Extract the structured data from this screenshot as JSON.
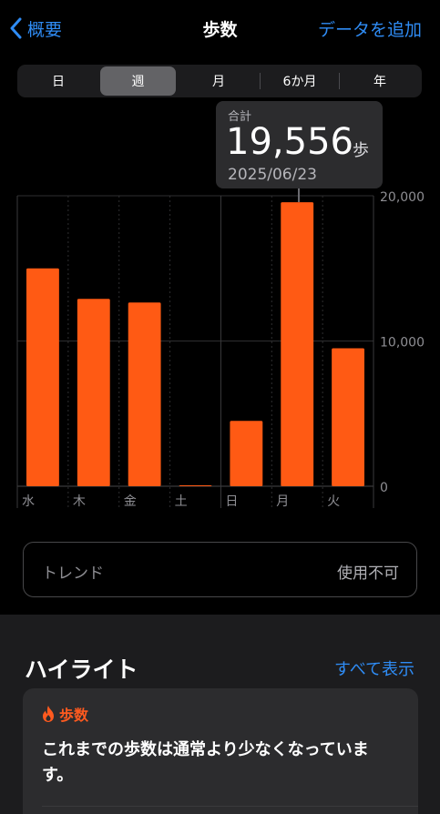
{
  "nav": {
    "back_label": "概要",
    "title": "歩数",
    "add_label": "データを追加"
  },
  "segments": [
    "日",
    "週",
    "月",
    "6か月",
    "年"
  ],
  "selected_segment": "週",
  "callout": {
    "label": "合計",
    "value": "19,556",
    "unit": "歩",
    "date": "2025/06/23"
  },
  "chart_data": {
    "type": "bar",
    "categories": [
      "水",
      "木",
      "金",
      "土",
      "日",
      "月",
      "火"
    ],
    "values": [
      15000,
      12900,
      12650,
      50,
      4500,
      19556,
      9500
    ],
    "ylim": [
      0,
      20000
    ],
    "yticks": [
      "0",
      "10,000",
      "20,000"
    ],
    "bar_color": "#ff5a14",
    "highlighted_index": 5
  },
  "trend": {
    "label": "トレンド",
    "value": "使用不可"
  },
  "highlights": {
    "title": "ハイライト",
    "show_all": "すべて表示",
    "card": {
      "category": "歩数",
      "text": "これまでの歩数は通常より少なくなっています。"
    }
  },
  "colors": {
    "accent": "#2f8cf5",
    "bar": "#ff5a14",
    "background": "#000000"
  }
}
